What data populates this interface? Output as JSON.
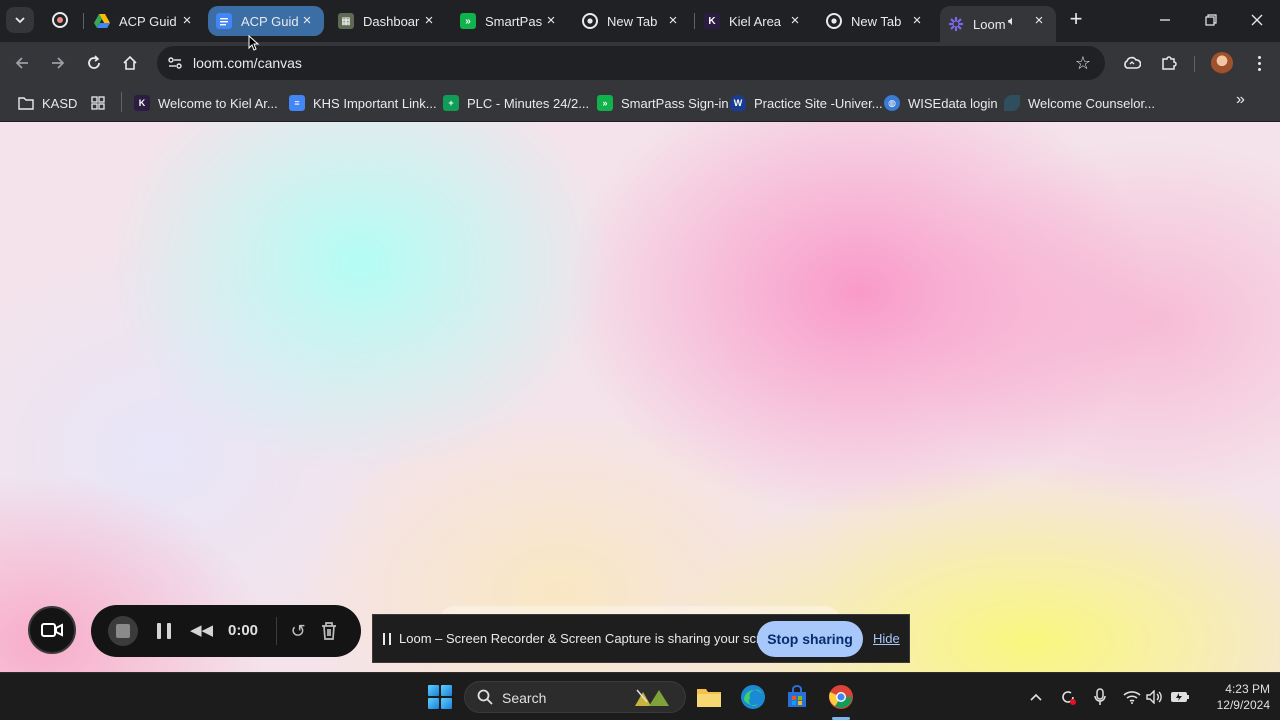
{
  "browser": {
    "tabs": [
      {
        "title": "ACP Guid",
        "favicon": "google-drive-icon",
        "state": "normal"
      },
      {
        "title": "ACP Guid",
        "favicon": "google-docs-icon",
        "state": "selected"
      },
      {
        "title": "Dashboar",
        "favicon": "dashboard-icon",
        "state": "normal"
      },
      {
        "title": "SmartPas",
        "favicon": "smartpass-icon",
        "state": "normal"
      },
      {
        "title": "New Tab",
        "favicon": "chrome-icon",
        "state": "normal"
      },
      {
        "title": "Kiel Area",
        "favicon": "kiel-icon",
        "state": "normal"
      },
      {
        "title": "New Tab",
        "favicon": "chrome-icon",
        "state": "normal"
      },
      {
        "title": "Loom",
        "favicon": "loom-icon",
        "state": "active",
        "audible": true
      }
    ],
    "url": "loom.com/canvas",
    "bookmarks": [
      {
        "label": "KASD",
        "icon": "folder-icon"
      },
      {
        "label": "",
        "icon": "apps-grid-icon"
      },
      {
        "label": "Welcome to Kiel Ar...",
        "icon": "kiel-icon"
      },
      {
        "label": "KHS Important Link...",
        "icon": "google-docs-icon"
      },
      {
        "label": "PLC - Minutes 24/2...",
        "icon": "google-sheets-icon"
      },
      {
        "label": "SmartPass Sign-in",
        "icon": "smartpass-icon"
      },
      {
        "label": "Practice Site -Univer...",
        "icon": "shield-icon"
      },
      {
        "label": "WISEdata login",
        "icon": "globe-icon"
      },
      {
        "label": "Welcome Counselor...",
        "icon": "leaf-icon"
      }
    ]
  },
  "loom": {
    "timer": "0:00",
    "share_message": "Loom – Screen Recorder & Screen Capture is sharing your screen.",
    "stop_sharing_label": "Stop sharing",
    "hide_label": "Hide"
  },
  "taskbar": {
    "search_label": "Search",
    "time": "4:23 PM",
    "date": "12/9/2024"
  },
  "colors": {
    "tab_selected": "#3c6ea6",
    "stop_sharing_bg": "#a8c7fa",
    "accent_link": "#a8c7fa"
  }
}
